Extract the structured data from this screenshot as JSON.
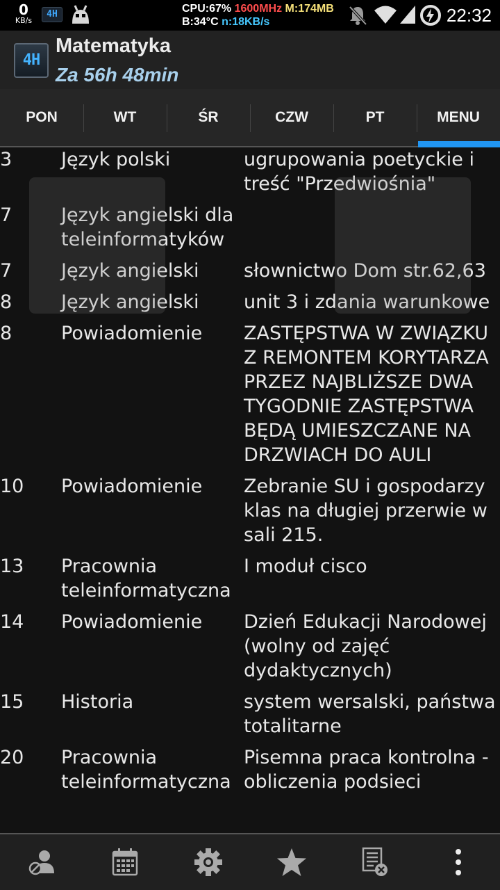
{
  "status_bar": {
    "net_speed_value": "0",
    "net_speed_unit": "KB/s",
    "app_badge": "4H",
    "cpu": "CPU:67%",
    "freq": "1600MHz",
    "mem": "M:174MB",
    "battery_temp": "B:34°C",
    "net": "n:18KB/s",
    "time": "22:32"
  },
  "action_bar": {
    "logo_text": "4H",
    "title": "Matematyka",
    "subtitle": "Za 56h 48min"
  },
  "tabs": [
    {
      "label": "PON",
      "active": false
    },
    {
      "label": "WT",
      "active": false
    },
    {
      "label": "ŚR",
      "active": false
    },
    {
      "label": "CZW",
      "active": false
    },
    {
      "label": "PT",
      "active": false
    },
    {
      "label": "MENU",
      "active": true
    }
  ],
  "entries": [
    {
      "day": "3",
      "subject": "Język polski",
      "note": "ugrupowania poetyckie i treść \"Przedwiośnia\""
    },
    {
      "day": "7",
      "subject": "Język angielski dla teleinformatyków",
      "note": ""
    },
    {
      "day": "7",
      "subject": "Język angielski",
      "note": "słownictwo Dom str.62,63"
    },
    {
      "day": "8",
      "subject": "Język angielski",
      "note": "unit 3 i zdania warunkowe"
    },
    {
      "day": "8",
      "subject": "Powiadomienie",
      "note": "ZASTĘPSTWA W ZWIĄZKU Z REMONTEM KORYTARZA PRZEZ NAJBLIŻSZE DWA TYGODNIE ZASTĘPSTWA BĘDĄ UMIESZCZANE NA DRZWIACH DO AULI"
    },
    {
      "day": "10",
      "subject": "Powiadomienie",
      "note": "Zebranie SU i gospodarzy klas na długiej przerwie w sali 215."
    },
    {
      "day": "13",
      "subject": "Pracownia teleinformatyczna",
      "note": "I moduł cisco"
    },
    {
      "day": "14",
      "subject": "Powiadomienie",
      "note": "Dzień Edukacji Narodowej (wolny od zajęć dydaktycznych)"
    },
    {
      "day": "15",
      "subject": "Historia",
      "note": "system wersalski, państwa totalitarne"
    },
    {
      "day": "20",
      "subject": "Pracownia teleinformatyczna",
      "note": "Pisemna praca kontrolna - obliczenia podsieci"
    }
  ],
  "bottom_bar": [
    {
      "icon": "person-off-icon"
    },
    {
      "icon": "calendar-icon"
    },
    {
      "icon": "gear-icon"
    },
    {
      "icon": "star-icon"
    },
    {
      "icon": "notes-remove-icon"
    },
    {
      "icon": "overflow-menu-icon"
    }
  ],
  "colors": {
    "accent": "#2196f3",
    "freq": "#ff4d4d",
    "mem": "#f5e079",
    "net": "#46c8ff",
    "subtitle": "#a8d0ec"
  }
}
